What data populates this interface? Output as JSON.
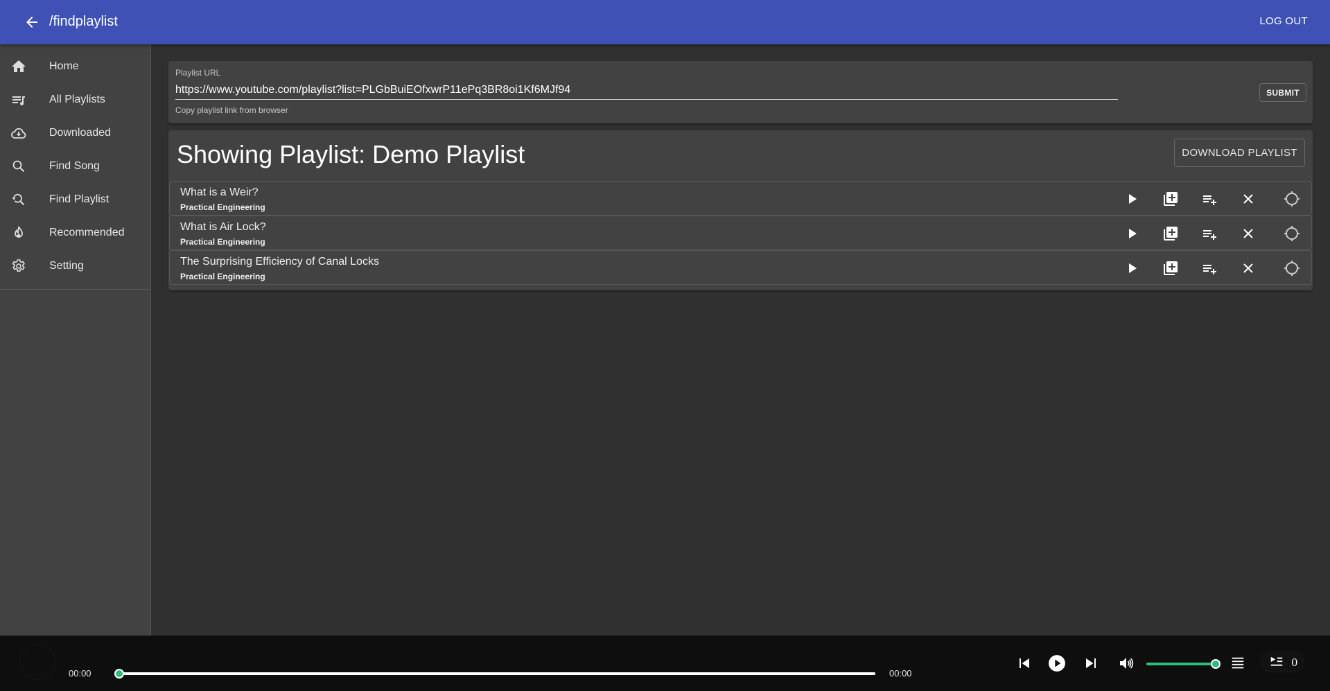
{
  "appbar": {
    "title": "/findplaylist",
    "logout_label": "LOG OUT",
    "color": "#3f51b5"
  },
  "sidebar": {
    "items": [
      {
        "label": "Home",
        "icon": "home-icon"
      },
      {
        "label": "All Playlists",
        "icon": "playlist-music-icon"
      },
      {
        "label": "Downloaded",
        "icon": "cloud-download-icon"
      },
      {
        "label": "Find Song",
        "icon": "search-icon"
      },
      {
        "label": "Find Playlist",
        "icon": "search-history-icon"
      },
      {
        "label": "Recommended",
        "icon": "fire-icon"
      },
      {
        "label": "Setting",
        "icon": "gear-icon"
      }
    ]
  },
  "url_form": {
    "label": "Playlist URL",
    "value": "https://www.youtube.com/playlist?list=PLGbBuiEOfxwrP11ePq3BR8oi1Kf6MJf94",
    "helper": "Copy playlist link from browser",
    "submit_label": "SUBMIT"
  },
  "playlist": {
    "heading": "Showing Playlist: Demo Playlist",
    "download_label": "DOWNLOAD PLAYLIST",
    "songs": [
      {
        "title": "What is a Weir?",
        "artist": "Practical Engineering"
      },
      {
        "title": "What is Air Lock?",
        "artist": "Practical Engineering"
      },
      {
        "title": "The Surprising Efficiency of Canal Locks",
        "artist": "Practical Engineering"
      }
    ],
    "row_actions": [
      "play-icon",
      "library-add-icon",
      "playlist-add-icon",
      "close-icon",
      "crosshair-icon"
    ]
  },
  "player": {
    "current_time": "00:00",
    "duration": "00:00",
    "progress_fraction": 0,
    "volume_fraction": 1,
    "queue_count": "0",
    "accent": "#2ebd7b"
  }
}
